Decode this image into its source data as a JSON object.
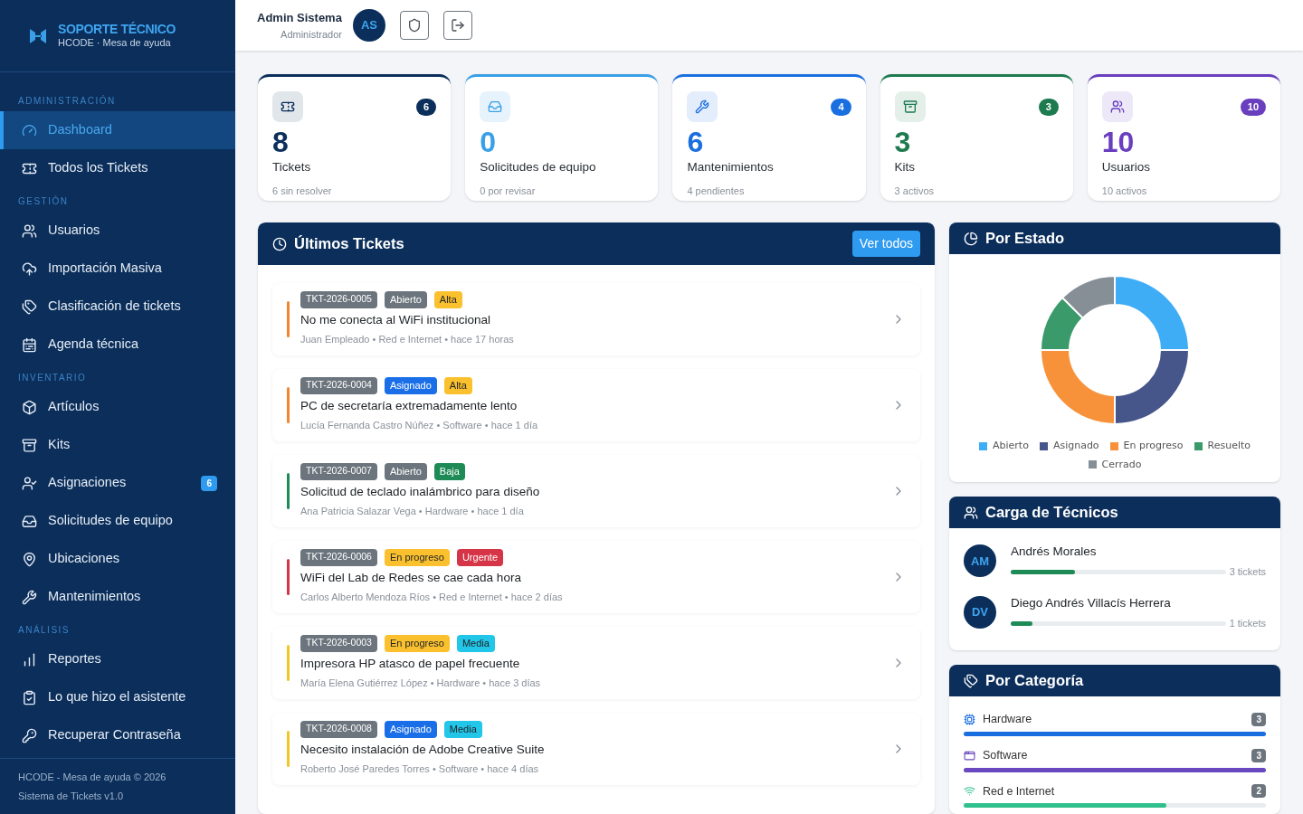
{
  "sidebar": {
    "brand": {
      "title": "SOPORTE TÉCNICO",
      "subtitle": "HCODE · Mesa de ayuda"
    },
    "sections": [
      {
        "label": "ADMINISTRACIÓN",
        "items": [
          {
            "label": "Dashboard",
            "selected": true
          },
          {
            "label": "Todos los Tickets",
            "selected": false
          }
        ]
      },
      {
        "label": "GESTIÓN",
        "items": [
          {
            "label": "Usuarios",
            "selected": false
          },
          {
            "label": "Importación Masiva",
            "selected": false
          },
          {
            "label": "Clasificación de tickets",
            "selected": false
          },
          {
            "label": "Agenda técnica",
            "selected": false
          }
        ]
      },
      {
        "label": "INVENTARIO",
        "items": [
          {
            "label": "Artículos",
            "selected": false
          },
          {
            "label": "Kits",
            "selected": false
          },
          {
            "label": "Asignaciones",
            "selected": false,
            "badge": "6"
          },
          {
            "label": "Solicitudes de equipo",
            "selected": false
          },
          {
            "label": "Ubicaciones",
            "selected": false
          },
          {
            "label": "Mantenimientos",
            "selected": false
          }
        ]
      },
      {
        "label": "ANÁLISIS",
        "items": [
          {
            "label": "Reportes",
            "selected": false
          },
          {
            "label": "Lo que hizo el asistente",
            "selected": false
          },
          {
            "label": "Recuperar Contraseña",
            "selected": false
          }
        ]
      }
    ],
    "footer": [
      "HCODE - Mesa de ayuda © 2026",
      "Sistema de Tickets v1.0"
    ]
  },
  "header": {
    "user_name": "Admin Sistema",
    "user_role": "Administrador",
    "avatar": "AS"
  },
  "stats": [
    {
      "value": "8",
      "label": "Tickets",
      "note": "6 sin resolver",
      "badge": "6",
      "color": "#0b2e5b"
    },
    {
      "value": "0",
      "label": "Solicitudes de equipo",
      "note": "0 por revisar",
      "color": "#3aa0e6"
    },
    {
      "value": "6",
      "label": "Mantenimientos",
      "note": "4 pendientes",
      "badge": "4",
      "color": "#1a6fe0"
    },
    {
      "value": "3",
      "label": "Kits",
      "note": "3 activos",
      "badge": "3",
      "color": "#1e7a4f"
    },
    {
      "value": "10",
      "label": "Usuarios",
      "note": "10 activos",
      "badge": "10",
      "color": "#6a3fbf"
    }
  ],
  "latest": {
    "title": "Últimos Tickets",
    "action": "Ver todos",
    "tickets": [
      {
        "code": "TKT-2026-0005",
        "status": {
          "text": "Abierto",
          "color": "#6c757d"
        },
        "priority": {
          "text": "Alta",
          "color": "#fbc02d"
        },
        "color": "#f0862f",
        "title": "No me conecta al WiFi institucional",
        "meta": "Juan Empleado • Red e Internet • hace 17 horas"
      },
      {
        "code": "TKT-2026-0004",
        "status": {
          "text": "Asignado",
          "color": "#1a6fe8"
        },
        "priority": {
          "text": "Alta",
          "color": "#fbc02d"
        },
        "color": "#f0862f",
        "title": "PC de secretaría extremadamente lento",
        "meta": "Lucía Fernanda Castro Núñez • Software • hace 1 día"
      },
      {
        "code": "TKT-2026-0007",
        "status": {
          "text": "Abierto",
          "color": "#6c757d"
        },
        "priority": {
          "text": "Baja",
          "color": "#1e8a55"
        },
        "color": "#1e8a55",
        "title": "Solicitud de teclado inalámbrico para diseño",
        "meta": "Ana Patricia Salazar Vega • Hardware • hace 1 día"
      },
      {
        "code": "TKT-2026-0006",
        "status": {
          "text": "En progreso",
          "color": "#fbc02d"
        },
        "priority": {
          "text": "Urgente",
          "color": "#d63447"
        },
        "color": "#d63447",
        "title": "WiFi del Lab de Redes se cae cada hora",
        "meta": "Carlos Alberto Mendoza Ríos • Red e Internet • hace 2 días"
      },
      {
        "code": "TKT-2026-0003",
        "status": {
          "text": "En progreso",
          "color": "#fbc02d"
        },
        "priority": {
          "text": "Media",
          "color": "#22c6e8"
        },
        "color": "#f2c624",
        "title": "Impresora HP atasco de papel frecuente",
        "meta": "María Elena Gutiérrez López • Hardware • hace 3 días"
      },
      {
        "code": "TKT-2026-0008",
        "status": {
          "text": "Asignado",
          "color": "#1a6fe8"
        },
        "priority": {
          "text": "Media",
          "color": "#22c6e8"
        },
        "color": "#f2c624",
        "title": "Necesito instalación de Adobe Creative Suite",
        "meta": "Roberto José Paredes Torres • Software • hace 4 días"
      }
    ]
  },
  "by_status": {
    "title": "Por Estado",
    "chart_data": {
      "type": "donut",
      "legend": "bottom",
      "categories": [
        "Abierto",
        "Asignado",
        "En progreso",
        "Resuelto",
        "Cerrado"
      ],
      "series": [
        {
          "values": [
            25,
            25,
            25,
            12.5,
            12.5
          ],
          "colors": [
            "#3fadf6",
            "#46558a",
            "#f7923a",
            "#3a9a6a",
            "#868e96"
          ]
        }
      ]
    }
  },
  "techs": {
    "title": "Carga de Técnicos",
    "items": [
      {
        "initials": "AM",
        "name": "Andrés Morales",
        "level": 0.3,
        "count": "3 tickets"
      },
      {
        "initials": "DV",
        "name": "Diego Andrés Villacís Herrera",
        "level": 0.1,
        "count": "1 tickets"
      }
    ]
  },
  "categories": {
    "title": "Por Categoría",
    "items": [
      {
        "name": "Hardware",
        "count": "3",
        "level": 1,
        "color": "#1a6fe0"
      },
      {
        "name": "Software",
        "count": "3",
        "level": 1,
        "color": "#6a48c0"
      },
      {
        "name": "Red e Internet",
        "count": "2",
        "level": 0.67,
        "color": "#2fc08e"
      }
    ]
  }
}
